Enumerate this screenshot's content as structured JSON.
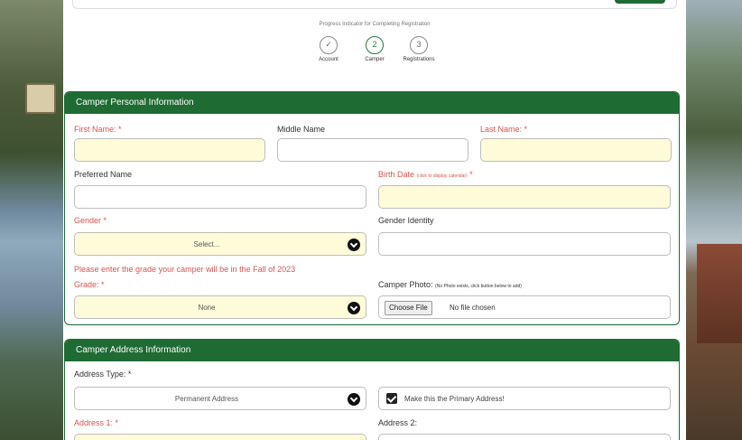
{
  "progress": {
    "title": "Progress Indicator for Completing Registration",
    "steps": [
      {
        "number": "✓",
        "label": "Account"
      },
      {
        "number": "2",
        "label": "Camper"
      },
      {
        "number": "3",
        "label": "Registrations"
      }
    ]
  },
  "personal": {
    "header": "Camper Personal Information",
    "first_name_label": "First Name: *",
    "middle_name_label": "Middle Name",
    "last_name_label": "Last Name: *",
    "preferred_name_label": "Preferred Name",
    "birth_date_label": "Birth Date",
    "birth_date_hint": "(click to display calendar)",
    "birth_date_req": " *",
    "gender_label": "Gender *",
    "gender_value": "Select...",
    "gender_identity_label": "Gender Identity",
    "grade_warning": "Please enter the grade your camper will be in the Fall of 2023",
    "grade_label": "Grade: *",
    "grade_value": "None",
    "photo_label": "Camper Photo:",
    "photo_hint": "(No Photo exists, click button below to add)",
    "photo_button": "Choose File",
    "photo_status": "No file chosen"
  },
  "address": {
    "header": "Camper Address Information",
    "type_label": "Address Type: *",
    "type_value": "Permanent Address",
    "primary_label": "Make this the Primary Address!",
    "address1_label": "Address 1: *",
    "address2_label": "Address 2:"
  },
  "colors": {
    "brand_green": "#1e6b34",
    "required_red": "#d9534f",
    "required_field_bg": "#fefbd8"
  }
}
